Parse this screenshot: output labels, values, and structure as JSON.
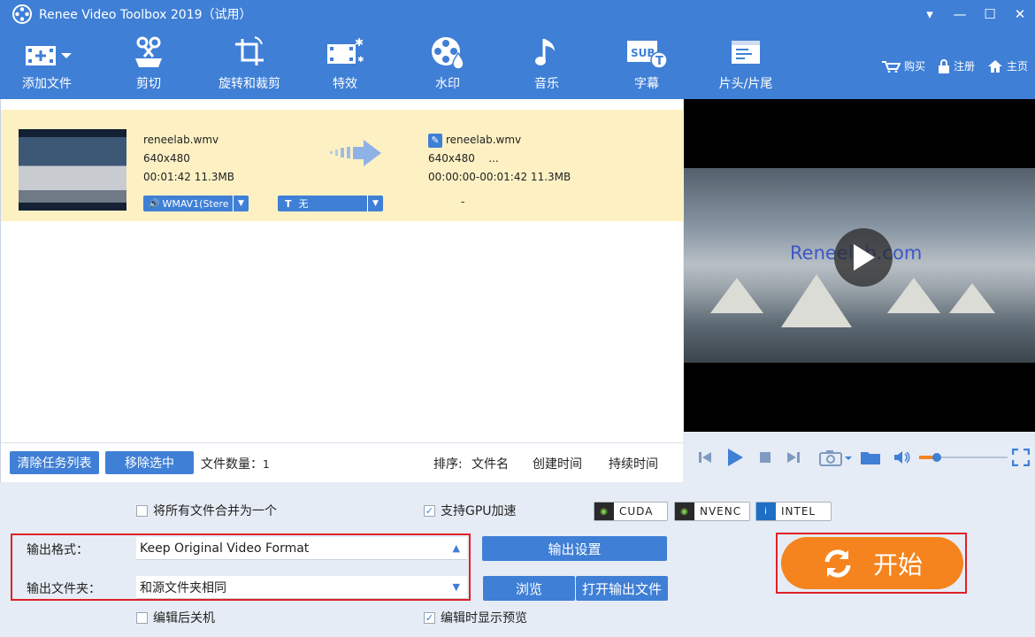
{
  "app": {
    "title": "Renee Video Toolbox 2019（试用）",
    "window_buttons": [
      "▾",
      "—",
      "☐",
      "✕"
    ]
  },
  "toolbar": {
    "items": [
      {
        "label": "添加文件",
        "icon": "add-file-icon"
      },
      {
        "label": "剪切",
        "icon": "cut-icon"
      },
      {
        "label": "旋转和裁剪",
        "icon": "rotate-crop-icon"
      },
      {
        "label": "特效",
        "icon": "effects-icon"
      },
      {
        "label": "水印",
        "icon": "watermark-icon"
      },
      {
        "label": "音乐",
        "icon": "music-icon"
      },
      {
        "label": "字幕",
        "icon": "subtitle-icon"
      },
      {
        "label": "片头/片尾",
        "icon": "intro-outro-icon"
      }
    ],
    "links": {
      "buy": "购买",
      "register": "注册",
      "home": "主页"
    }
  },
  "task": {
    "source": {
      "name": "reneelab.wmv",
      "resolution": "640x480",
      "duration_size": "00:01:42 11.3MB"
    },
    "output": {
      "name": "reneelab.wmv",
      "resolution": "640x480",
      "more": "...",
      "range_size": "00:00:00-00:01:42 11.3MB"
    },
    "audio_track": "WMAV1(Stere",
    "subtitle": "无",
    "dash": "-"
  },
  "preview": {
    "watermark": "Reneelab.com"
  },
  "list_bar": {
    "clear_label": "清除任务列表",
    "remove_label": "移除选中",
    "count_label": "文件数量：",
    "count_value": "1",
    "sort_label": "排序:",
    "sort_name": "文件名",
    "sort_created": "创建时间",
    "sort_duration": "持续时间"
  },
  "settings": {
    "merge_label": "将所有文件合并为一个",
    "merge_checked": false,
    "gpu_label": "支持GPU加速",
    "gpu_checked": true,
    "gpu_badges": [
      "CUDA",
      "NVENC",
      "INTEL"
    ],
    "format_label": "输出格式：",
    "format_value": "Keep Original Video Format",
    "folder_label": "输出文件夹：",
    "folder_value": "和源文件夹相同",
    "output_settings_label": "输出设置",
    "browse_label": "浏览",
    "open_output_label": "打开输出文件",
    "shutdown_label": "编辑后关机",
    "shutdown_checked": false,
    "preview_label": "编辑时显示预览",
    "preview_checked": true,
    "start_label": "开始"
  },
  "colors": {
    "accent": "#3f7fd6",
    "highlight_row": "#fdf1c4",
    "start": "#f5841f",
    "alert_border": "#e0202a"
  }
}
